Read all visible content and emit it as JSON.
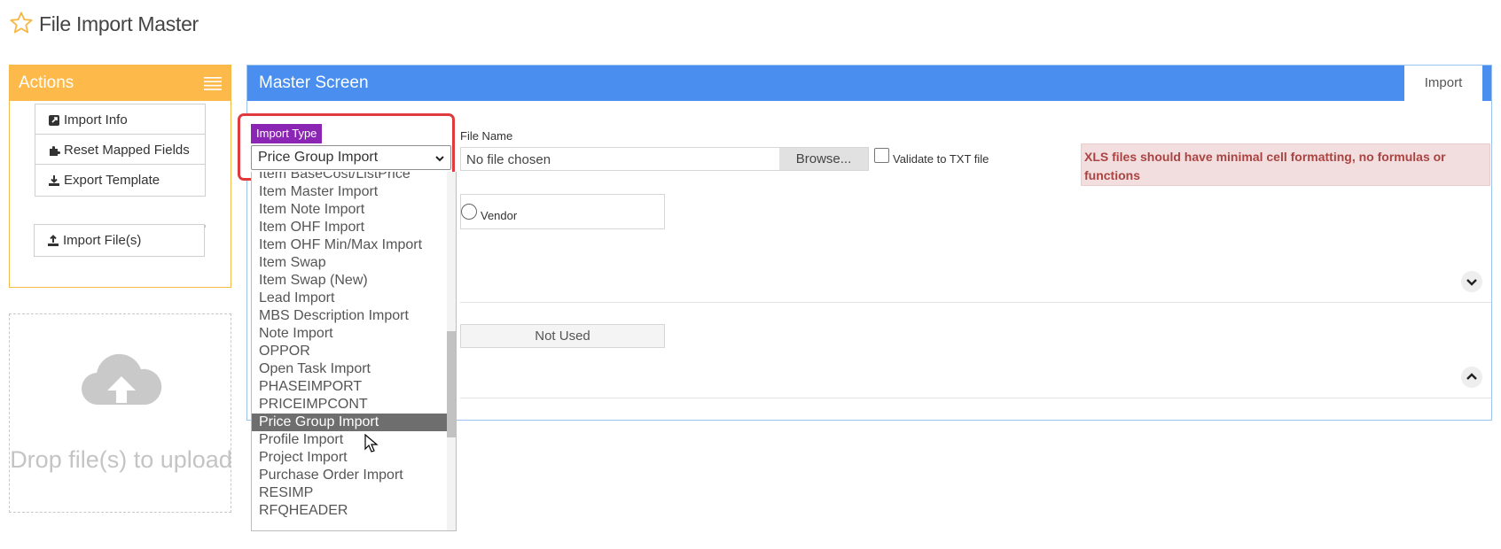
{
  "page": {
    "title": "File Import Master",
    "title_icon": "star-icon"
  },
  "actions": {
    "title": "Actions",
    "menu_icon": "hamburger-icon",
    "items": [
      {
        "label": "Import Info",
        "icon": "external-link-icon"
      },
      {
        "label": "Reset Mapped Fields",
        "icon": "puzzle-icon"
      },
      {
        "label": "Export Template",
        "icon": "download-icon"
      }
    ],
    "import_files_label": "Import File(s)",
    "import_files_icon": "upload-icon"
  },
  "dropzone": {
    "text": "Drop file(s) to upload",
    "icon": "cloud-upload-icon"
  },
  "master": {
    "title": "Master Screen",
    "tab_label": "Import",
    "import_type_label": "Import Type",
    "import_type_value": "Price Group Import",
    "file_name_label": "File Name",
    "file_placeholder": "No file chosen",
    "browse_label": "Browse...",
    "validate_label": "Validate to TXT file",
    "warning": "XLS files should have minimal cell formatting, no formulas or functions",
    "vendor_label": "Vendor",
    "not_used_label": "Not Used"
  },
  "dropdown": {
    "options": [
      "Item BaseCost/ListPrice",
      "Item Master Import",
      "Item Note Import",
      "Item OHF Import",
      "Item OHF Min/Max Import",
      "Item Swap",
      "Item Swap (New)",
      "Lead Import",
      "MBS Description Import",
      "Note Import",
      "OPPOR",
      "Open Task Import",
      "PHASEIMPORT",
      "PRICEIMPCONT",
      "Price Group Import",
      "Profile Import",
      "Project Import",
      "Purchase Order Import",
      "RESIMP",
      "RFQHEADER"
    ],
    "selected": "Price Group Import"
  },
  "colors": {
    "actions_header": "#fdb94a",
    "master_header": "#4a8ff0",
    "import_type_badge": "#8b25b4",
    "highlight_border": "#e0393e",
    "warning_text": "#a94442",
    "warning_bg": "#f2dede"
  }
}
